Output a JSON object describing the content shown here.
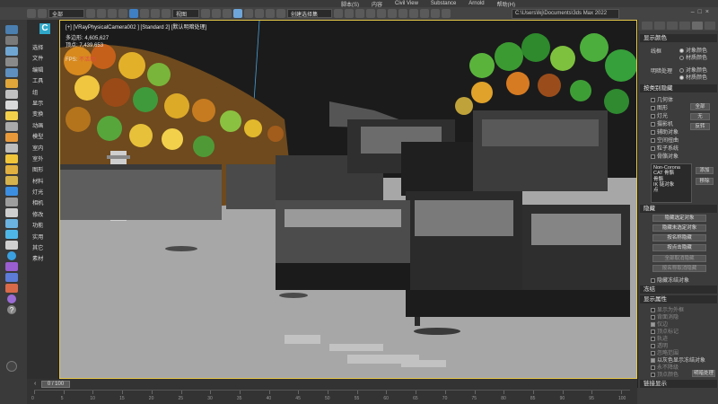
{
  "menu": {
    "items": [
      "脚本(S)",
      "内容",
      "Civil View",
      "Substance",
      "Arnold",
      "帮助(H)"
    ]
  },
  "toolbar": {
    "selection_set": "全部",
    "view_dropdown": "视图",
    "named_set_placeholder": "创建选择集",
    "path": "C:\\Users\\lkj\\Documents\\3ds Max 2022"
  },
  "explorer": {
    "items": [
      "选择",
      "文件",
      "编辑",
      "工具",
      "组",
      "显示",
      "变换",
      "动画",
      "模型",
      "室内",
      "室外",
      "图形",
      "材料",
      "灯光",
      "相机",
      "修改",
      "功能",
      "实用",
      "其它",
      "素材"
    ]
  },
  "viewport": {
    "label": "[+] [VRayPhysicalCamera002 ] [Standard 2] [默认明暗处理]",
    "stats": {
      "polys_label": "多边形:",
      "polys_value": "4,605,627",
      "verts_label": "顶点:",
      "verts_value": "7,439,653",
      "fps_label": "FPS:",
      "fps_value": "不活动"
    }
  },
  "command_panel": {
    "rollout_display_color": "显示颜色",
    "wireframe_label": "线框",
    "shaded_label": "明暗处理",
    "opt_object_color": "对象颜色",
    "opt_material_color": "材质颜色",
    "rollout_hide_by_category": "按类别隐藏",
    "categories": [
      "几何体",
      "图形",
      "灯光",
      "摄影机",
      "辅助对象",
      "空间扭曲",
      "粒子系统",
      "骨骼对象"
    ],
    "btn_all": "全部",
    "btn_none": "无",
    "btn_invert": "反转",
    "filter_list": [
      "Non-Corona",
      "CAT 骨骼",
      "骨骼",
      "IK 链对象",
      "点"
    ],
    "btn_add": "添加",
    "btn_remove": "移除",
    "rollout_hide": "隐藏",
    "hide_buttons": [
      "隐藏选定对象",
      "隐藏未选定对象",
      "按名称隐藏",
      "按点击隐藏",
      "全部取消隐藏",
      "按名称取消隐藏"
    ],
    "chk_hide_frozen": "隐藏冻结对象",
    "rollout_freeze": "冻结",
    "rollout_display_props": "显示属性",
    "display_props": [
      "显示为外框",
      "背面消隐",
      "仅边",
      "顶点标记",
      "轨迹",
      "透明",
      "忽略范围",
      "以灰色显示冻结对象",
      "永不降级",
      "顶点颜色"
    ],
    "btn_shaded": "明暗处理",
    "rollout_link_display": "链接显示"
  },
  "timeline": {
    "slider": "0 / 100",
    "ticks": [
      "0",
      "5",
      "10",
      "15",
      "20",
      "25",
      "30",
      "35",
      "40",
      "45",
      "50",
      "55",
      "60",
      "65",
      "70",
      "75",
      "80",
      "85",
      "90",
      "95",
      "100"
    ]
  }
}
